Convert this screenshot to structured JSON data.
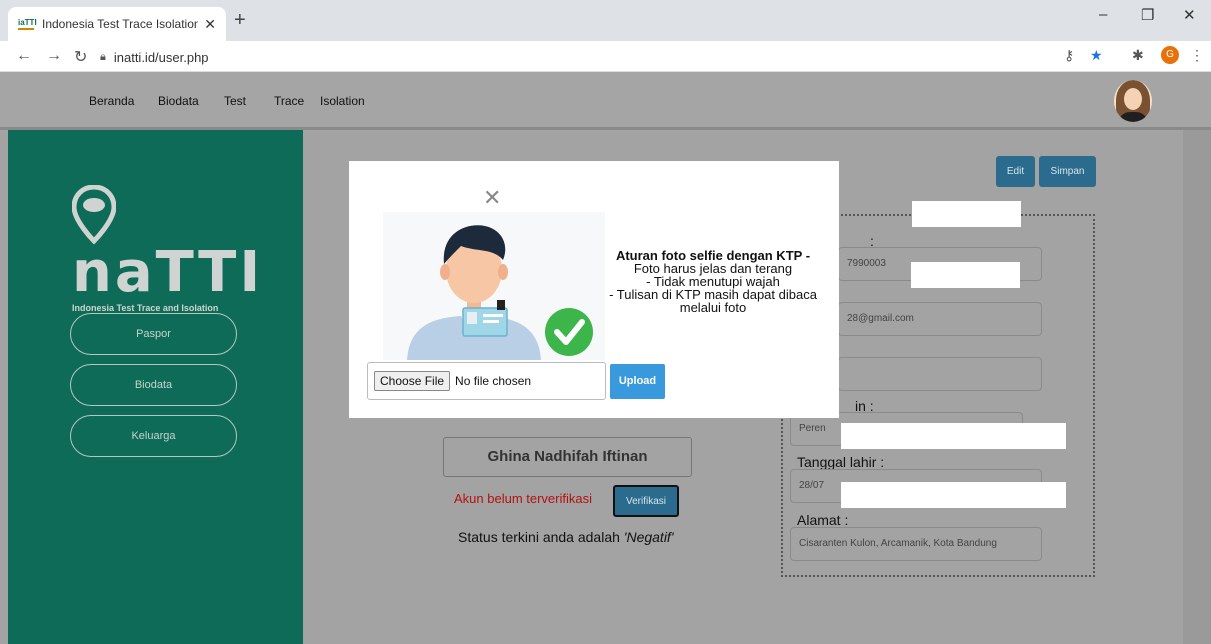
{
  "browser": {
    "tab_title": "Indonesia Test Trace Isolation",
    "favicon_text": "iaTTI",
    "url": "inatti.id/user.php",
    "profile_initial": "G"
  },
  "navbar": {
    "items": [
      "Beranda",
      "Biodata",
      "Test",
      "Trace",
      "Isolation"
    ]
  },
  "sidebar": {
    "logo_word": "naTTI",
    "logo_sub": "Indonesia Test Trace and Isolation",
    "buttons": [
      "Paspor",
      "Biodata",
      "Keluarga"
    ]
  },
  "main": {
    "edit_label": "Edit",
    "save_label": "Simpan",
    "name": "Ghina Nadhifah Iftinan",
    "unverified_text": "Akun belum terverifikasi",
    "verify_label": "Verifikasi",
    "status_prefix": "Status terkini anda adalah",
    "status_value": "'Negatif'",
    "fields": {
      "nik_label_tail": ":",
      "nik_value": "7990003",
      "email_value": "28@gmail.com",
      "gender_label_tail": "in :",
      "gender_value": "Peren",
      "birth_label": "Tanggal lahir :",
      "birth_value": "28/07",
      "address_label": "Alamat :",
      "address_value": "Cisaranten Kulon, Arcamanik, Kota Bandung"
    }
  },
  "modal": {
    "close_symbol": "✕",
    "rules_title": "Aturan foto selfie dengan KTP -",
    "rules_lines": [
      "Foto harus jelas dan terang",
      "- Tidak menutupi wajah",
      "- Tulisan di KTP masih dapat dibaca",
      "melalui foto"
    ],
    "choose_file_label": "Choose File",
    "no_file_text": "No file chosen",
    "upload_label": "Upload"
  },
  "colors": {
    "sidebar": "#0d6b57",
    "upload": "#3899dd",
    "verify": "#2b6c8e",
    "check": "#3cb64a"
  }
}
